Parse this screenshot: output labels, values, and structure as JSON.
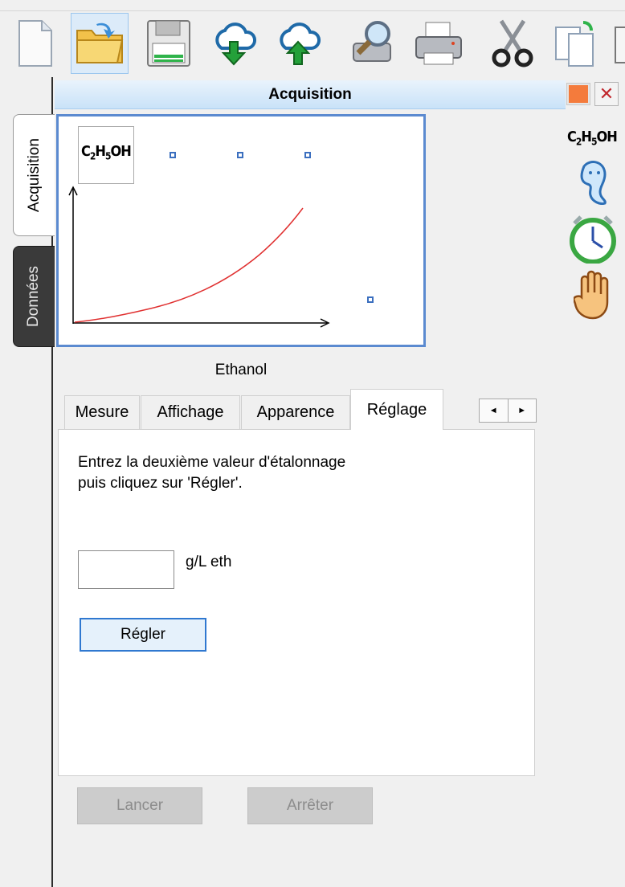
{
  "panel": {
    "title": "Acquisition"
  },
  "side_tabs": {
    "acquisition": "Acquisition",
    "donnees": "Données"
  },
  "graph": {
    "formula": "C2H5OH",
    "caption": "Ethanol"
  },
  "right_column": {
    "formula": "C2H5OH"
  },
  "tabs": [
    "Mesure",
    "Affichage",
    "Apparence",
    "Réglage"
  ],
  "active_tab": "Réglage",
  "tab_scroll": {
    "left": "◄",
    "right": "►"
  },
  "calibration": {
    "instruction_line1": "Entrez la deuxième valeur d'étalonnage",
    "instruction_line2": "puis cliquez sur 'Régler'.",
    "value": "",
    "unit": "g/L eth",
    "button": "Régler"
  },
  "bottom_buttons": {
    "start": "Lancer",
    "stop": "Arrêter"
  },
  "colors": {
    "header": "#c9e2f8",
    "graph_border": "#5b8ad0",
    "curve": "#e03030",
    "accent_button": "#2f78d0"
  },
  "icons": [
    "new-file-icon",
    "open-folder-icon",
    "save-icon",
    "download-icon",
    "upload-icon",
    "zoom-search-icon",
    "print-icon",
    "cut-icon",
    "copy-icon"
  ]
}
